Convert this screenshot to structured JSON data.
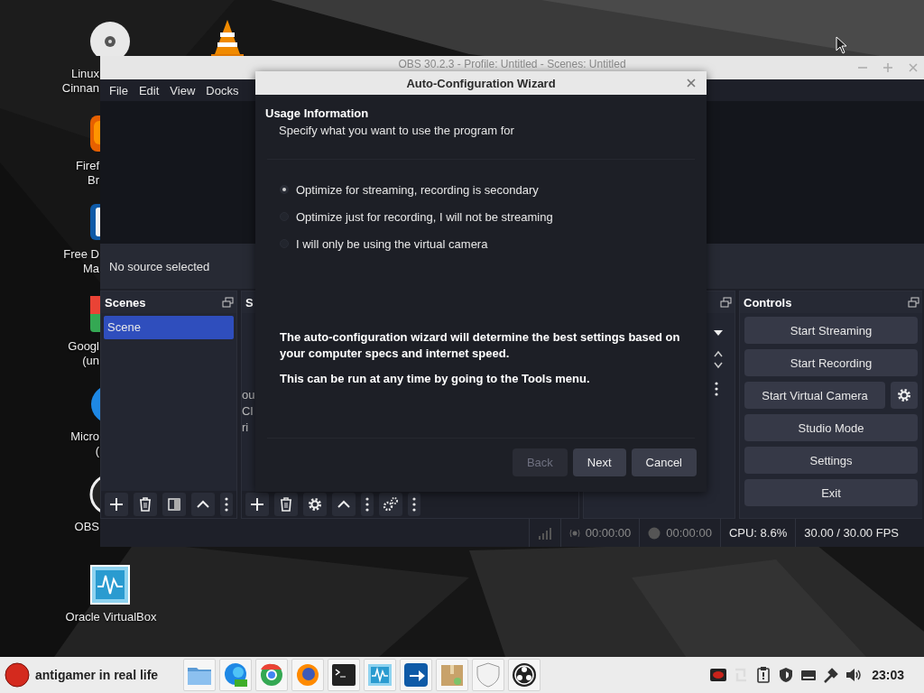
{
  "desktop_icons": [
    {
      "kind": "disc",
      "lines": [
        "Linux",
        "Cinnan"
      ]
    },
    {
      "kind": "cone"
    },
    {
      "kind": "firefox",
      "lines": [
        "Firef",
        "Br"
      ]
    },
    {
      "kind": "download",
      "lines": [
        "Free D",
        "Ma"
      ]
    },
    {
      "kind": "chrome",
      "lines": [
        "Googl",
        "(un"
      ]
    },
    {
      "kind": "edge",
      "lines": [
        "Micro",
        "("
      ]
    },
    {
      "kind": "obs",
      "lines": [
        "OBS"
      ]
    },
    {
      "kind": "vbox",
      "lines": [
        "Oracle VirtualBox"
      ]
    }
  ],
  "obs_window": {
    "title": "OBS 30.2.3 - Profile: Untitled - Scenes: Untitled",
    "menu": [
      "File",
      "Edit",
      "View",
      "Docks"
    ],
    "source_status": "No source selected",
    "scenes": {
      "title": "Scenes",
      "items": [
        {
          "label": "Scene",
          "selected": true
        }
      ]
    },
    "sources": {
      "title": "S",
      "fragments": [
        "ou",
        "Cl",
        "ri"
      ]
    },
    "controls": {
      "title": "Controls",
      "buttons": [
        "Start Streaming",
        "Start Recording",
        "Start Virtual Camera",
        "Studio Mode",
        "Settings",
        "Exit"
      ]
    },
    "status_bar": {
      "stream_time": "00:00:00",
      "record_time": "00:00:00",
      "cpu": "CPU: 8.6%",
      "fps": "30.00 / 30.00 FPS"
    }
  },
  "dialog": {
    "title": "Auto-Configuration Wizard",
    "heading": "Usage Information",
    "subheading": "Specify what you want to use the program for",
    "options": [
      {
        "label": "Optimize for streaming, recording is secondary",
        "selected": true
      },
      {
        "label": "Optimize just for recording, I will not be streaming",
        "selected": false
      },
      {
        "label": "I will only be using the virtual camera",
        "selected": false
      }
    ],
    "notes": [
      "The auto-configuration wizard will determine the best settings based on your computer specs and internet speed.",
      "This can be run at any time by going to the Tools menu."
    ],
    "buttons": [
      {
        "label": "Back",
        "disabled": true
      },
      {
        "label": "Next",
        "disabled": false
      },
      {
        "label": "Cancel",
        "disabled": false
      }
    ]
  },
  "taskbar": {
    "user": "antigamer in real life",
    "apps": [
      {
        "kind": "folder"
      },
      {
        "kind": "edge"
      },
      {
        "kind": "chrome"
      },
      {
        "kind": "firefox"
      },
      {
        "kind": "terminal"
      },
      {
        "kind": "monitor"
      },
      {
        "kind": "download"
      },
      {
        "kind": "package"
      },
      {
        "kind": "shield"
      },
      {
        "kind": "obs"
      }
    ],
    "tray": [
      {
        "kind": "red"
      },
      {
        "kind": "sync"
      },
      {
        "kind": "clipboard"
      },
      {
        "kind": "shield"
      },
      {
        "kind": "drive"
      },
      {
        "kind": "network"
      },
      {
        "kind": "volume"
      }
    ],
    "clock": "23:03"
  }
}
